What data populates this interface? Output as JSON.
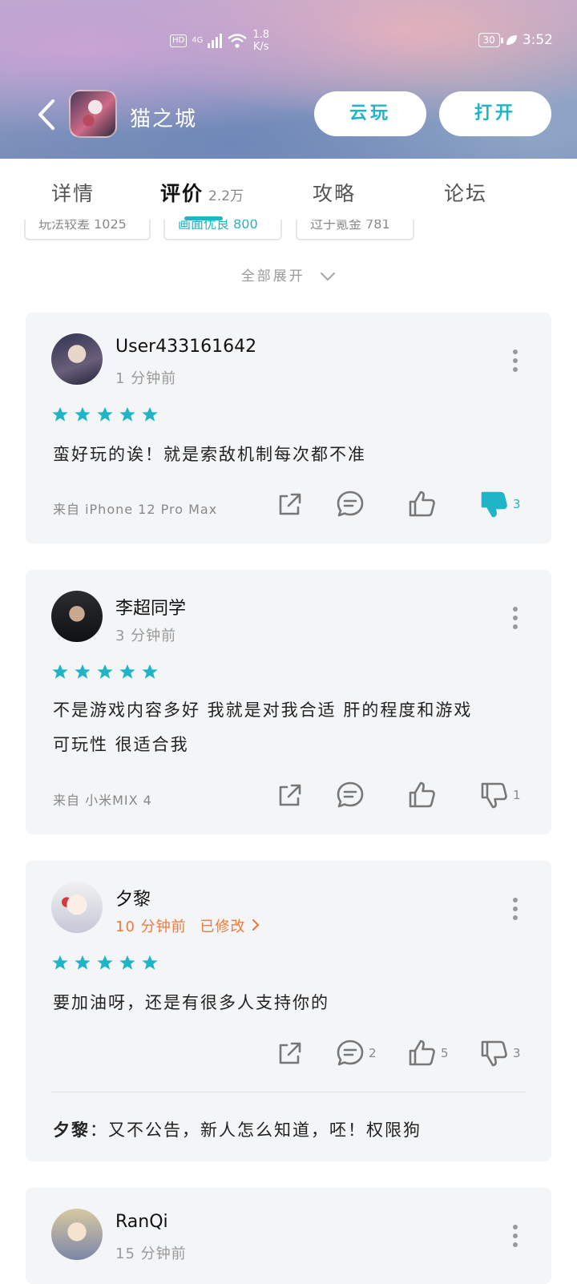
{
  "status_bar": {
    "network_hd": "HD",
    "network_type": "4G",
    "speed_value": "1.8",
    "speed_unit": "K/s",
    "battery": "30",
    "time": "3:52"
  },
  "header": {
    "app_name": "猫之城",
    "cloud_play_label": "云玩",
    "open_label": "打开"
  },
  "tabs": [
    {
      "label": "详情",
      "count": ""
    },
    {
      "label": "评价",
      "count": "2.2万"
    },
    {
      "label": "攻略",
      "count": ""
    },
    {
      "label": "论坛",
      "count": ""
    }
  ],
  "tag_chips": [
    "玩法较差 1025",
    "画面优良 800",
    "过于氪金 781"
  ],
  "expand_label": "全部展开",
  "reviews": [
    {
      "username": "User433161642",
      "time": "1 分钟前",
      "edited": "",
      "rating": 5,
      "text_lines": [
        "蛮好玩的诶！就是索敌机制每次都不准"
      ],
      "device": "来自 iPhone 12 Pro Max",
      "comment_count": "",
      "like_count": "",
      "dislike_count": "3",
      "dislike_active": true
    },
    {
      "username": "李超同学",
      "time": "3 分钟前",
      "edited": "",
      "rating": 5,
      "text_lines": [
        "不是游戏内容多好 我就是对我合适 肝的程度和游戏",
        "可玩性 很适合我"
      ],
      "device": "来自 小米MIX 4",
      "comment_count": "",
      "like_count": "",
      "dislike_count": "1",
      "dislike_active": false
    },
    {
      "username": "夕黎",
      "time": "10 分钟前",
      "edited": "已修改",
      "rating": 5,
      "text_lines": [
        "要加油呀，还是有很多人支持你的"
      ],
      "device": "",
      "comment_count": "2",
      "like_count": "5",
      "dislike_count": "3",
      "dislike_active": false,
      "reply": {
        "author": "夕黎",
        "separator": "：",
        "text": "又不公告，新人怎么知道，呸！权限狗"
      }
    },
    {
      "username": "RanQi",
      "time": "15 分钟前",
      "edited": "",
      "rating": 5,
      "text_lines": [],
      "device": ""
    }
  ],
  "colors": {
    "accent": "#1fb5c6",
    "edited": "#ee7a3e",
    "card_bg": "#f4f5f7"
  },
  "icons": [
    "back-chevron-icon",
    "share-icon",
    "comment-icon",
    "thumbs-up-icon",
    "thumbs-down-icon",
    "more-vertical-icon",
    "star-icon",
    "chevron-down-icon",
    "chevron-right-icon"
  ]
}
